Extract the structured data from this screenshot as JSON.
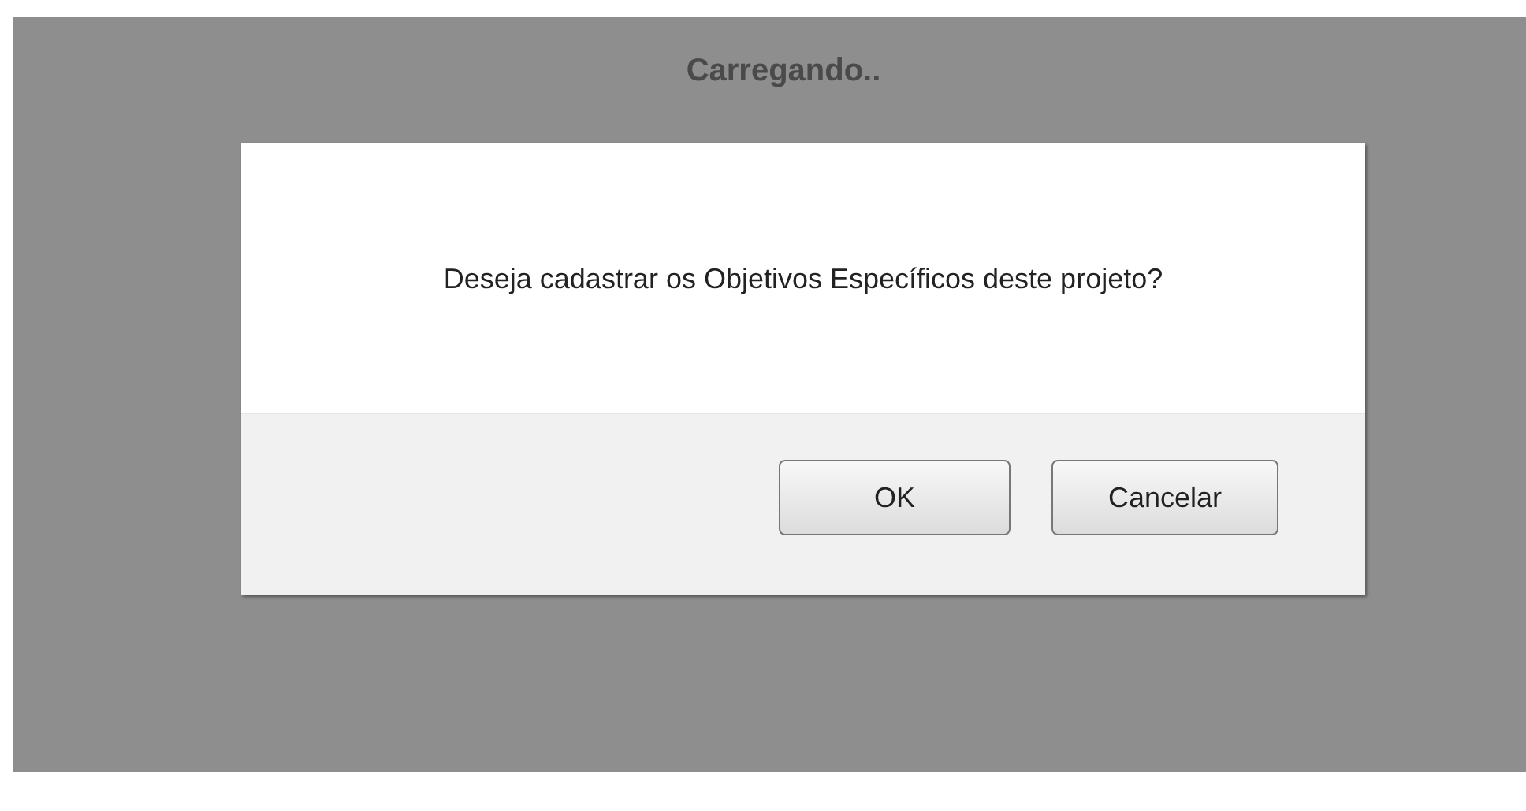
{
  "loading_text": "Carregando..",
  "dialog": {
    "message": "Deseja cadastrar os Objetivos Específicos deste projeto?",
    "buttons": [
      {
        "label": "OK",
        "kind": "confirm"
      },
      {
        "label": "Cancelar",
        "kind": "cancel"
      }
    ]
  }
}
